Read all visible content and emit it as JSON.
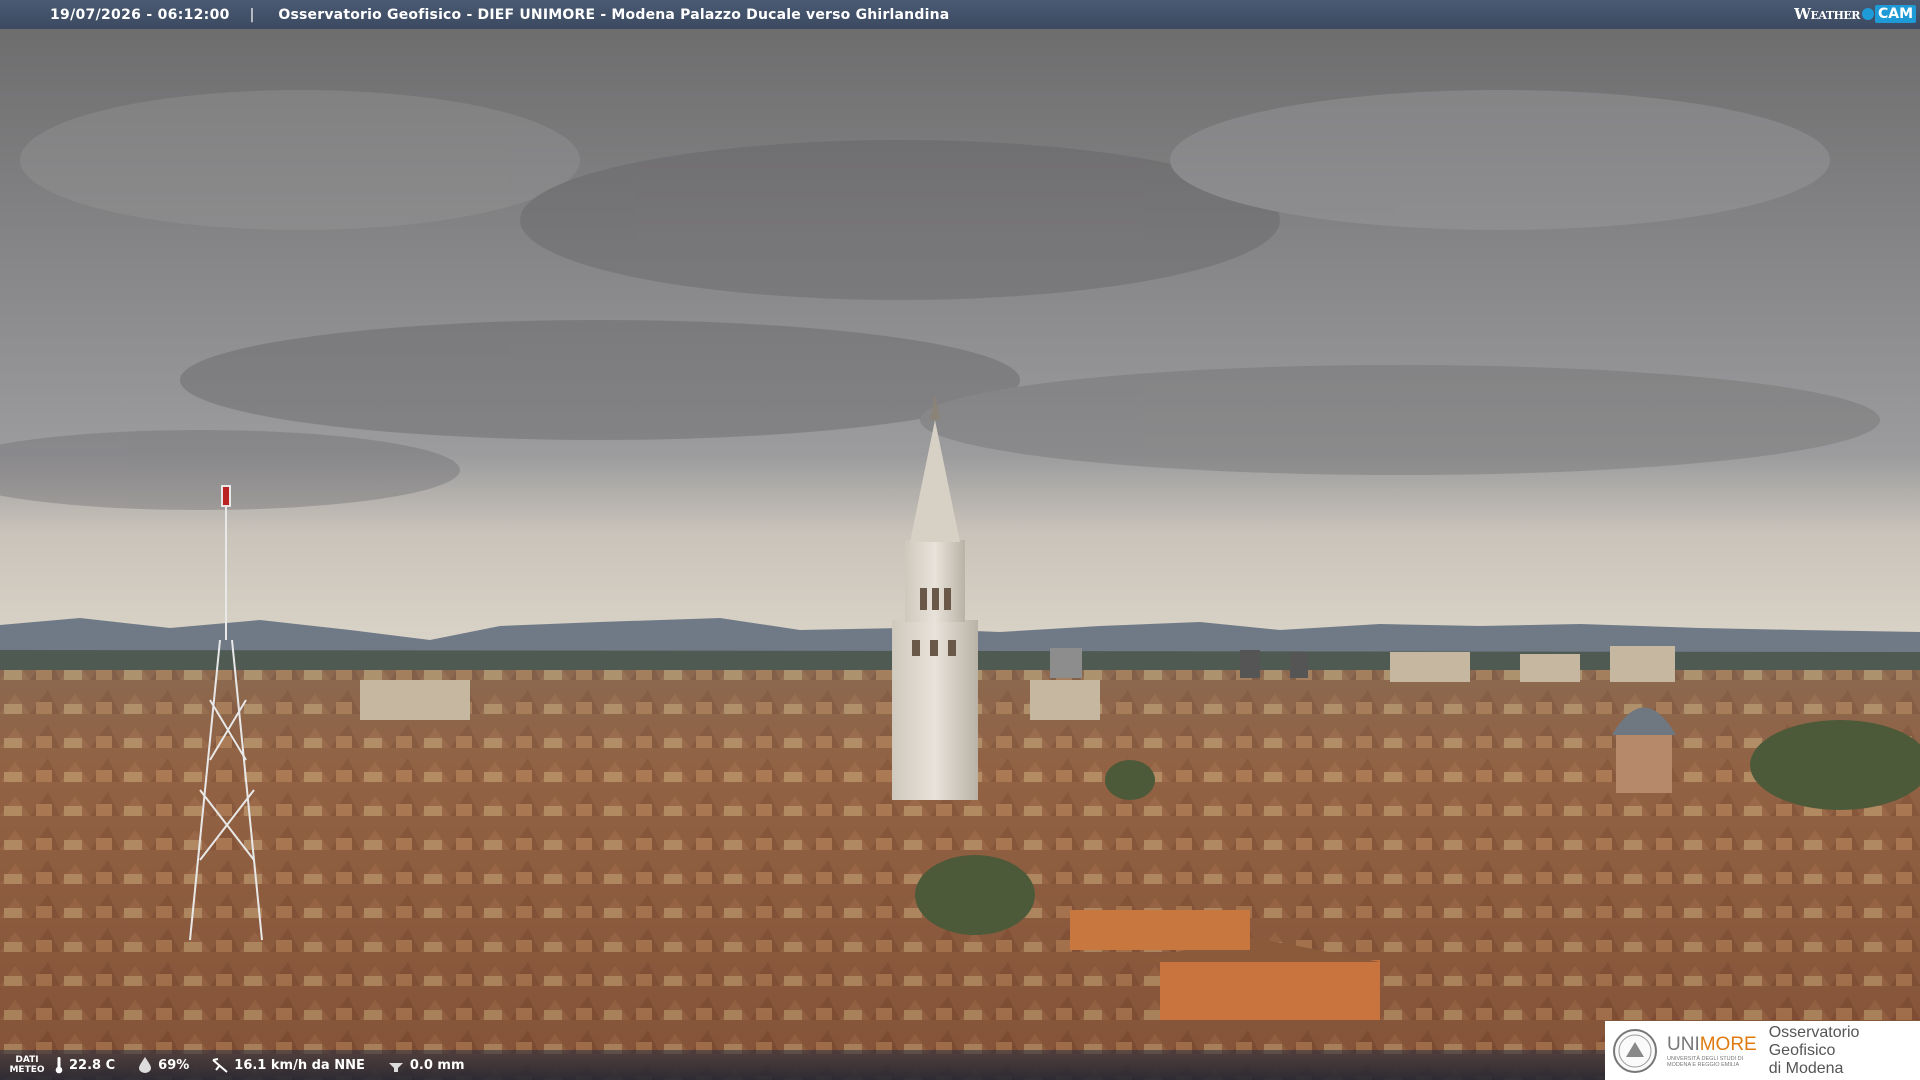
{
  "header": {
    "datetime": "19/07/2026 - 06:12:00",
    "separator": "|",
    "title": "Osservatorio Geofisico - DIEF UNIMORE - Modena Palazzo Ducale verso Ghirlandina",
    "brand_left": "Weather",
    "brand_right": "CAM"
  },
  "meteo": {
    "label_line1": "DATI",
    "label_line2": "METEO",
    "temperature": "22.8 C",
    "humidity": "69%",
    "wind": "16.1 km/h da NNE",
    "rain": "0.0 mm",
    "icons": [
      "thermometer-icon",
      "humidity-drop-icon",
      "wind-icon",
      "rain-gauge-icon"
    ]
  },
  "logo": {
    "uni_prefix": "UNI",
    "uni_suffix": "MORE",
    "uni_sub1": "UNIVERSITÀ DEGLI STUDI DI",
    "uni_sub2": "MODENA E REGGIO EMILIA",
    "obs_line1": "Osservatorio Geofisico",
    "obs_line2": "di Modena",
    "accent": "#e07a10"
  },
  "colors": {
    "bar": "#3b4a61",
    "brand_blue": "#1e9ad6"
  }
}
